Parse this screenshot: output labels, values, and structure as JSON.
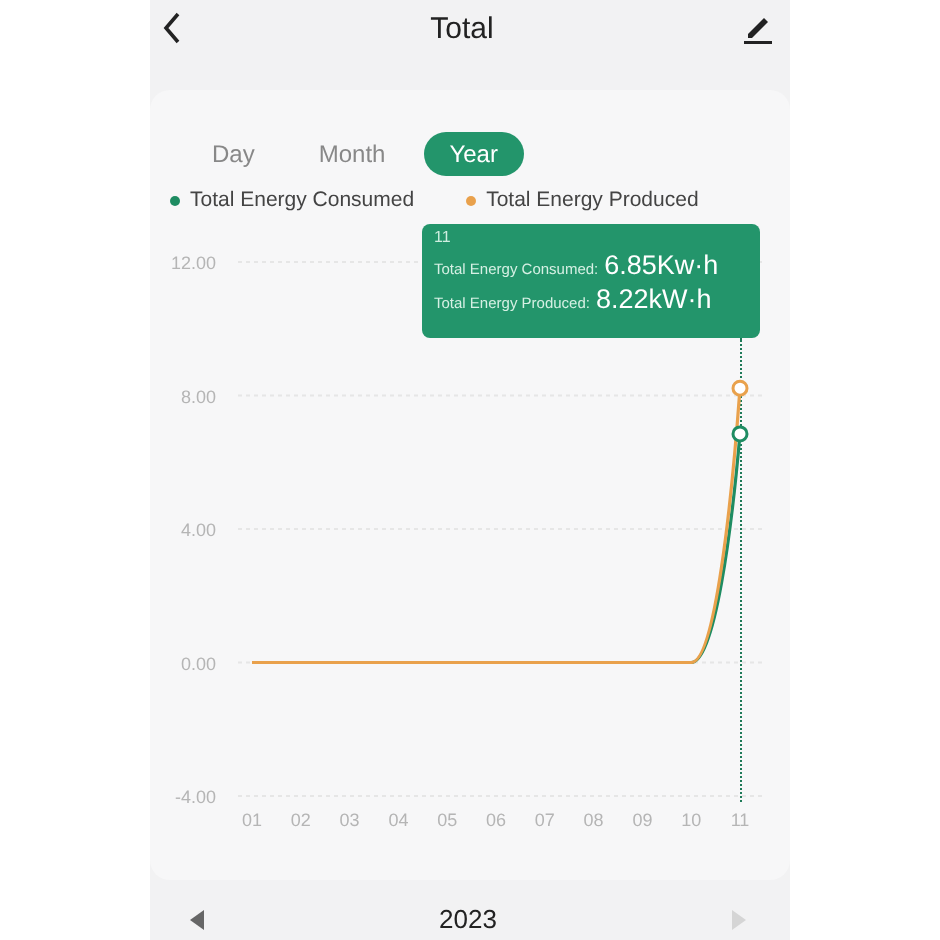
{
  "header": {
    "title": "Total"
  },
  "tabs": [
    {
      "label": "Day",
      "selected": false
    },
    {
      "label": "Month",
      "selected": false
    },
    {
      "label": "Year",
      "selected": true
    }
  ],
  "chart_data": {
    "type": "line",
    "grid": true,
    "categories": [
      "01",
      "02",
      "03",
      "04",
      "05",
      "06",
      "07",
      "08",
      "09",
      "10",
      "11"
    ],
    "ylim": [
      -4,
      12
    ],
    "yticks": [
      {
        "value": -4,
        "label": "-4.00"
      },
      {
        "value": 0,
        "label": "0.00"
      },
      {
        "value": 4,
        "label": "4.00"
      },
      {
        "value": 8,
        "label": "8.00"
      },
      {
        "value": 12,
        "label": "12.00"
      }
    ],
    "series": [
      {
        "name": "Total Energy Consumed",
        "color": "#1e8c62",
        "values": [
          null,
          null,
          null,
          null,
          null,
          null,
          null,
          null,
          null,
          0,
          6.85
        ]
      },
      {
        "name": "Total Energy Produced",
        "color": "#e9a14c",
        "values": [
          0,
          0,
          0,
          0,
          0,
          0,
          0,
          0,
          0,
          0,
          8.22
        ]
      }
    ]
  },
  "tooltip": {
    "category": "11",
    "rows": [
      {
        "label": "Total Energy Consumed:",
        "value": "6.85Kw·h"
      },
      {
        "label": "Total Energy Produced:",
        "value": "8.22kW·h"
      }
    ]
  },
  "year_nav": {
    "year": "2023",
    "prev_disabled": false,
    "next_disabled": true
  }
}
